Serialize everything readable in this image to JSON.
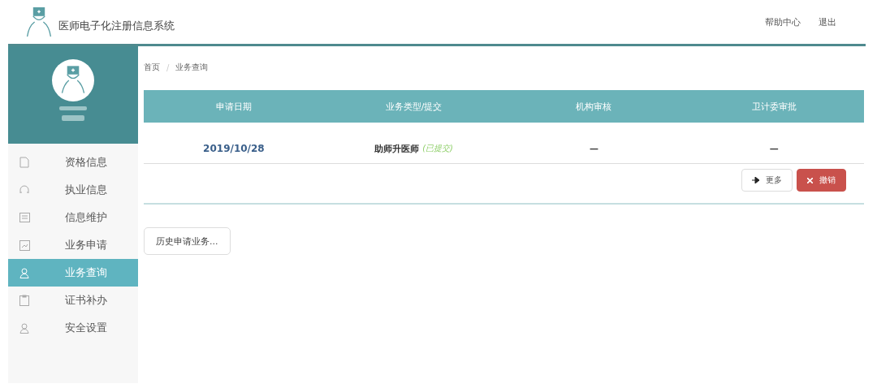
{
  "header": {
    "title": "医师电子化注册信息系统",
    "links": [
      "帮助中心",
      "退出"
    ]
  },
  "sidebar": {
    "items": [
      {
        "label": "资格信息",
        "kind": "document",
        "selected": false
      },
      {
        "label": "执业信息",
        "kind": "headset",
        "selected": false
      },
      {
        "label": "信息维护",
        "kind": "card",
        "selected": false
      },
      {
        "label": "业务申请",
        "kind": "form",
        "selected": false
      },
      {
        "label": "业务查询",
        "kind": "user",
        "selected": true
      },
      {
        "label": "证书补办",
        "kind": "clipboard",
        "selected": false
      },
      {
        "label": "安全设置",
        "kind": "user",
        "selected": false
      }
    ]
  },
  "breadcrumb": {
    "items": [
      "首页",
      "业务查询"
    ],
    "separator": "/"
  },
  "table": {
    "columns": [
      "申请日期",
      "业务类型/提交",
      "机构审核",
      "卫计委审批"
    ],
    "rows": [
      {
        "date": "2019/10/28",
        "type": "助师升医师",
        "status": "(已提交)",
        "org_review": "—",
        "commission_review": "—"
      }
    ]
  },
  "actions": [
    {
      "label": "更多",
      "kind": "more"
    },
    {
      "label": "撤销",
      "kind": "cancel"
    }
  ],
  "history_button": "历史申请业务..."
}
